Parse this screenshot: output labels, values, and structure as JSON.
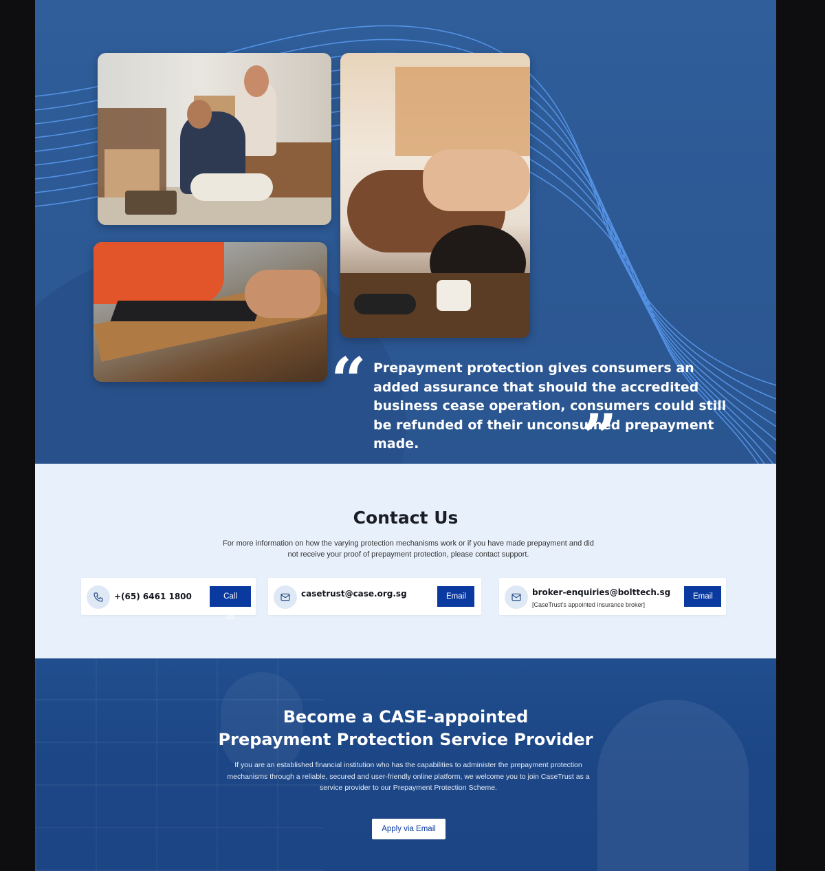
{
  "hero": {
    "images": [
      {
        "name": "family-moving-photo"
      },
      {
        "name": "spa-massage-photo"
      },
      {
        "name": "carpentry-jigsaw-photo"
      }
    ],
    "quote_open": "“",
    "quote_text": "Prepayment protection gives consumers an added assurance that should the accredited business cease operation, consumers could still be refunded of their unconsumed prepayment made.",
    "quote_close": "”"
  },
  "contact": {
    "title": "Contact Us",
    "description": "For more information on how the varying protection mechanisms work or if you have made prepayment and did not receive your proof of prepayment protection, please contact support.",
    "cards": [
      {
        "icon": "phone-icon",
        "value": "+(65) 6461 1800",
        "sub": "",
        "button": "Call us"
      },
      {
        "icon": "mail-icon",
        "value": "casetrust@case.org.sg",
        "sub": "",
        "button": "Email"
      },
      {
        "icon": "mail-icon",
        "value": "broker-enquiries@bolttech.sg",
        "sub": "[CaseTrust's appointed insurance broker]",
        "button": "Email"
      }
    ]
  },
  "provider": {
    "title_line1": "Become a CASE-appointed",
    "title_line2": "Prepayment Protection Service Provider",
    "description": "If you are an established financial institution who has the capabilities to administer the prepayment protection mechanisms through a reliable, secured and user-friendly online platform, we welcome you to join CaseTrust as a service provider to our Prepayment Protection Scheme.",
    "button": "Apply via Email"
  },
  "colors": {
    "hero_bg": "#2f5e9a",
    "contact_bg": "#e8f0fb",
    "button_primary": "#0a3aa0",
    "provider_bg": "#1c4685"
  }
}
